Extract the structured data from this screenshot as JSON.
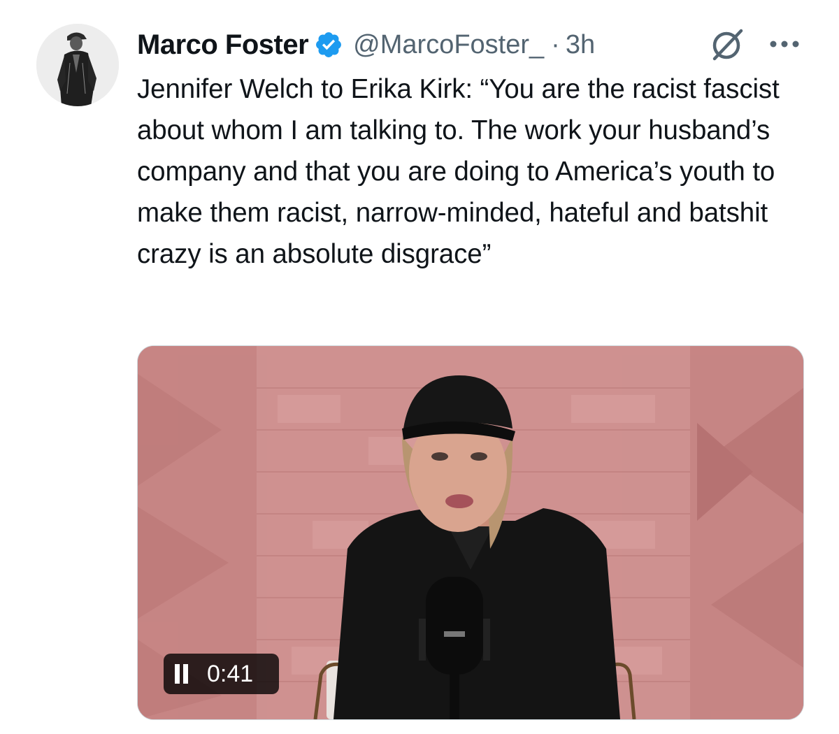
{
  "author": {
    "display_name": "Marco Foster",
    "handle": "@MarcoFoster_",
    "separator": "·",
    "time": "3h",
    "verified": true,
    "verified_color": "#1d9bf0"
  },
  "tweet": {
    "text": "Jennifer Welch to Erika Kirk: “You are the racist fascist about whom I am talking to. The work your husband’s company and that you are doing to America’s youth to make them racist, narrow-minded, hateful and batshit crazy is an absolute disgrace”"
  },
  "video": {
    "state": "playing",
    "duration": "0:41"
  },
  "icons": {
    "verified": "verified-badge-icon",
    "grok": "grok-icon",
    "more": "more-horizontal-icon",
    "pause": "pause-icon"
  },
  "colors": {
    "text": "#0f1419",
    "secondary_text": "#536471",
    "media_border": "#cfd9de",
    "video_wall": "#c88685"
  }
}
